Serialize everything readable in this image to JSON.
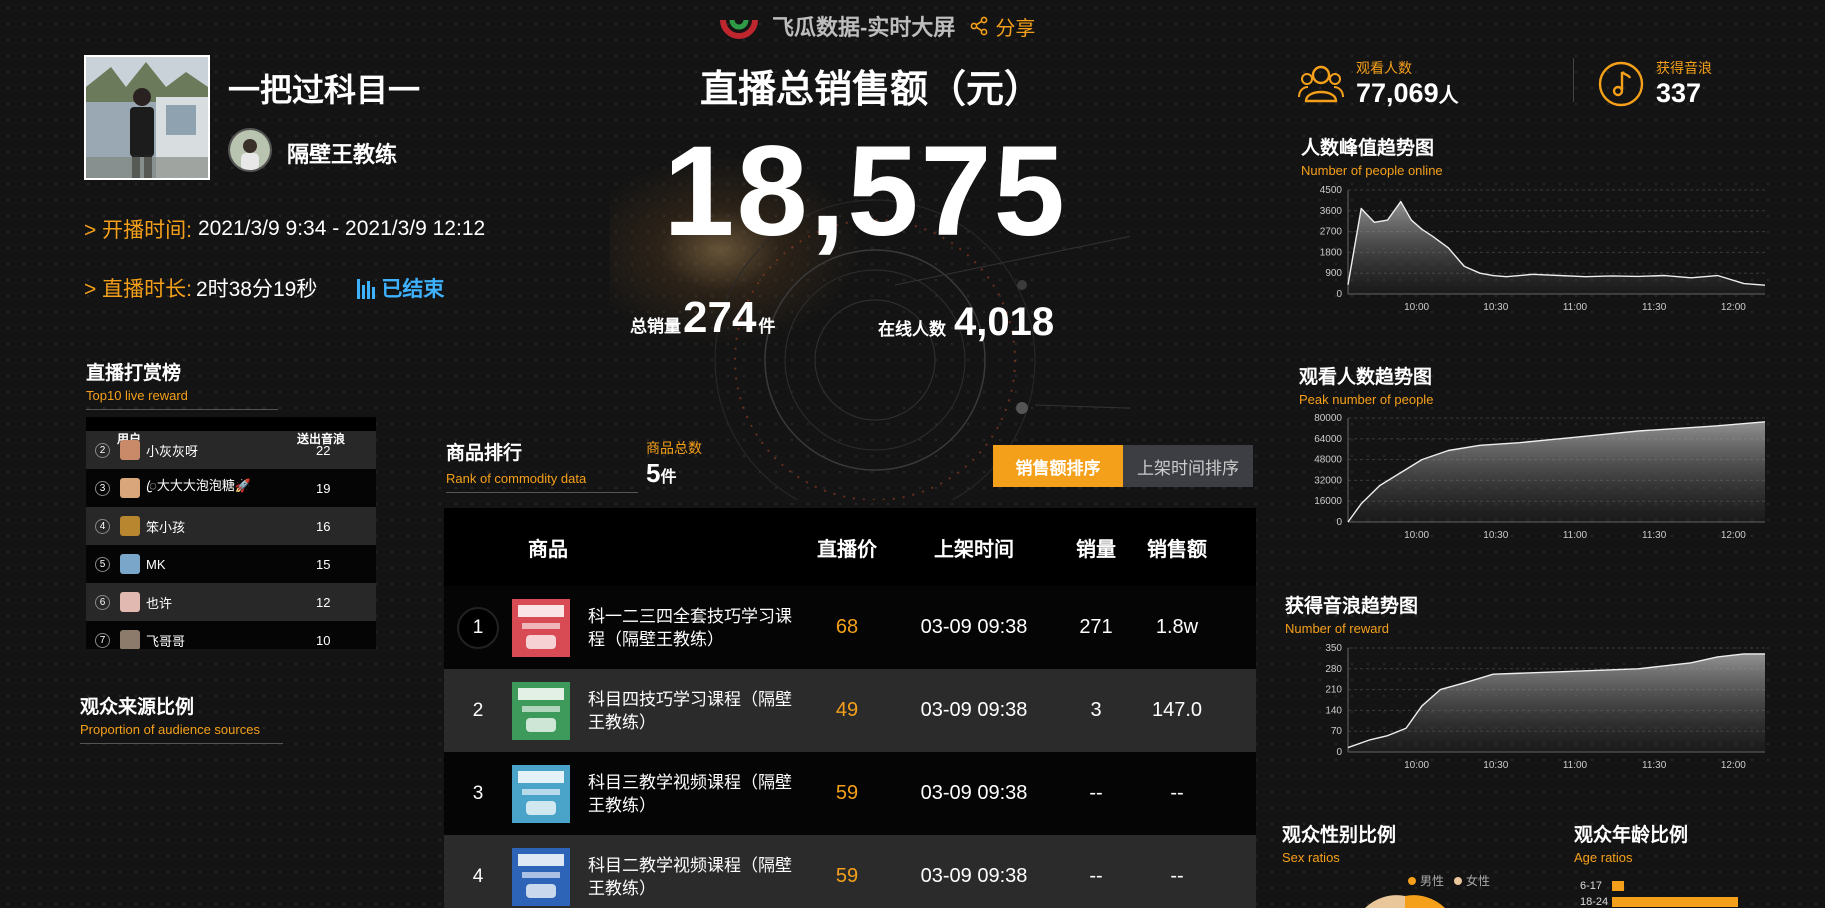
{
  "topbar": {
    "brand": "飞瓜数据-实时大屏",
    "share": "分享"
  },
  "live": {
    "room_title": "一把过科目一",
    "host_name": "隔壁王教练",
    "start_label": "> 开播时间:",
    "start_value": "2021/3/9 9:34 - 2021/3/9 12:12",
    "duration_label": "> 直播时长:",
    "duration_value": "2时38分19秒",
    "status": "已结束"
  },
  "sales": {
    "title": "直播总销售额（元）",
    "value": "18,575",
    "qty_label": "总销量",
    "qty_value": "274",
    "qty_unit": "件",
    "online_label": "在线人数",
    "online_value": "4,018"
  },
  "reward": {
    "title": "直播打赏榜",
    "subtitle": "Top10 live reward",
    "col_user": "用户",
    "col_value": "送出音浪",
    "rows": [
      {
        "rank": "2",
        "name": "小灰灰呀",
        "value": "22",
        "color": "#c98a6a"
      },
      {
        "rank": "3",
        "name": "ꦿ大大大泡泡糖🚀",
        "value": "19",
        "color": "#d9a57b"
      },
      {
        "rank": "4",
        "name": "笨小孩",
        "value": "16",
        "color": "#b8862e"
      },
      {
        "rank": "5",
        "name": "MK",
        "value": "15",
        "color": "#7aa6c9"
      },
      {
        "rank": "6",
        "name": "也许",
        "value": "12",
        "color": "#e2b9b0"
      },
      {
        "rank": "7",
        "name": "飞哥哥",
        "value": "10",
        "color": "#8c7a6b"
      }
    ]
  },
  "audience_source": {
    "title": "观众来源比例",
    "subtitle": "Proportion of audience sources"
  },
  "goods": {
    "title": "商品排行",
    "subtitle": "Rank of commodity data",
    "count_label": "商品总数",
    "count_value": "5",
    "count_unit": "件",
    "tabs": [
      "销售额排序",
      "上架时间排序"
    ],
    "headers": {
      "product": "商品",
      "price": "直播价",
      "time": "上架时间",
      "qty": "销量",
      "amount": "销售额"
    },
    "rows": [
      {
        "rank": "1",
        "name": "科一二三四全套技巧学习课程（隔壁王教练）",
        "price": "68",
        "time": "03-09 09:38",
        "qty": "271",
        "amount": "1.8w",
        "thumb": "#d94b54"
      },
      {
        "rank": "2",
        "name": "科目四技巧学习课程（隔壁王教练）",
        "price": "49",
        "time": "03-09 09:38",
        "qty": "3",
        "amount": "147.0",
        "thumb": "#3d9a5a"
      },
      {
        "rank": "3",
        "name": "科目三教学视频课程（隔壁王教练）",
        "price": "59",
        "time": "03-09 09:38",
        "qty": "--",
        "amount": "--",
        "thumb": "#4aa3c8"
      },
      {
        "rank": "4",
        "name": "科目二教学视频课程（隔壁王教练）",
        "price": "59",
        "time": "03-09 09:38",
        "qty": "--",
        "amount": "--",
        "thumb": "#2e64b8"
      }
    ]
  },
  "stats": {
    "viewers_label": "观看人数",
    "viewers_value": "77,069",
    "viewers_unit": "人",
    "sound_label": "获得音浪",
    "sound_value": "337"
  },
  "chart_data": [
    {
      "type": "area",
      "title": "人数峰值趋势图",
      "subtitle": "Number of people online",
      "ylim": [
        0,
        4500
      ],
      "yticks": [
        0,
        900,
        1800,
        2700,
        3600,
        4500
      ],
      "xticks": [
        "10:00",
        "10:30",
        "11:00",
        "11:30",
        "12:00"
      ],
      "x_minutes": [
        0,
        5,
        10,
        15,
        20,
        24,
        28,
        32,
        38,
        44,
        50,
        55,
        60,
        70,
        80,
        90,
        100,
        110,
        120,
        130,
        140,
        150,
        158
      ],
      "values": [
        400,
        3700,
        3100,
        3200,
        4000,
        3200,
        2800,
        2500,
        2000,
        1200,
        900,
        800,
        750,
        850,
        800,
        750,
        780,
        760,
        800,
        700,
        800,
        450,
        380
      ]
    },
    {
      "type": "area",
      "title": "观看人数趋势图",
      "subtitle": "Peak number of people",
      "ylim": [
        0,
        80000
      ],
      "yticks": [
        0,
        16000,
        32000,
        48000,
        64000,
        80000
      ],
      "xticks": [
        "10:00",
        "10:30",
        "11:00",
        "11:30",
        "12:00"
      ],
      "x_minutes": [
        0,
        5,
        12,
        20,
        28,
        38,
        50,
        65,
        80,
        95,
        110,
        125,
        140,
        158
      ],
      "values": [
        0,
        14000,
        28000,
        38000,
        48000,
        55000,
        59000,
        61000,
        64000,
        67000,
        70000,
        72000,
        74000,
        77069
      ]
    },
    {
      "type": "area",
      "title": "获得音浪趋势图",
      "subtitle": "Number of reward",
      "ylim": [
        0,
        350
      ],
      "yticks": [
        0,
        70,
        140,
        210,
        280,
        350
      ],
      "xticks": [
        "10:00",
        "10:30",
        "11:00",
        "11:30",
        "12:00"
      ],
      "x_minutes": [
        0,
        8,
        15,
        22,
        28,
        35,
        45,
        55,
        65,
        80,
        95,
        110,
        120,
        130,
        140,
        150,
        158
      ],
      "values": [
        15,
        40,
        55,
        80,
        155,
        210,
        235,
        262,
        265,
        270,
        275,
        280,
        290,
        300,
        320,
        330,
        330
      ]
    }
  ],
  "gender": {
    "title": "观众性别比例",
    "subtitle": "Sex ratios",
    "male": "男性",
    "female": "女性"
  },
  "age": {
    "title": "观众年龄比例",
    "subtitle": "Age ratios",
    "rows": [
      "6-17",
      "18-24"
    ]
  }
}
